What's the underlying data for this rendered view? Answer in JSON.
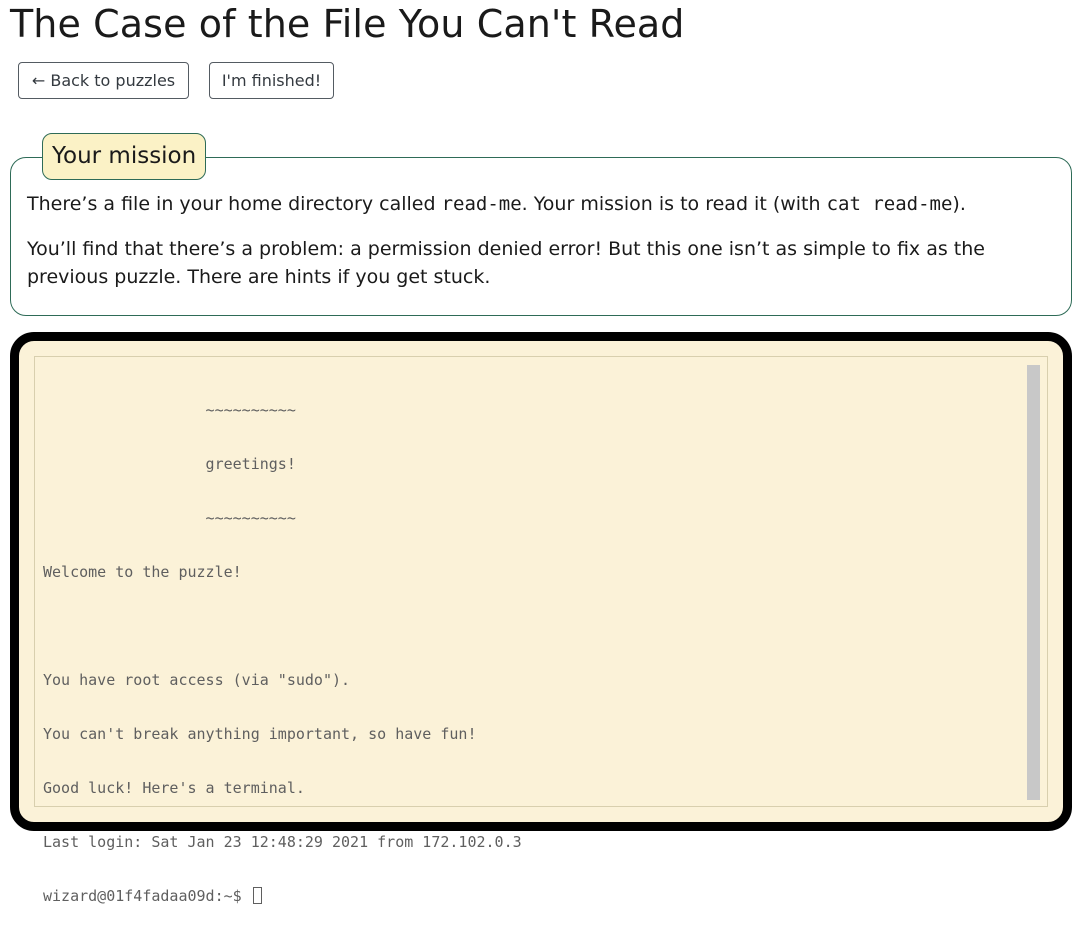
{
  "page": {
    "title": "The Case of the File You Can't Read"
  },
  "toolbar": {
    "back_label": "← Back to puzzles",
    "finished_label": "I'm finished!"
  },
  "mission": {
    "title": "Your mission",
    "p1_before": "There’s a file in your home directory called ",
    "p1_code1": "read-me",
    "p1_middle": ". Your mission is to read it (with ",
    "p1_code2": "cat read-me",
    "p1_after": ").",
    "p2": "You’ll find that there’s a problem: a permission denied error! But this one isn’t as simple to fix as the previous puzzle. There are hints if you get stuck."
  },
  "terminal": {
    "lines": [
      "                  ~~~~~~~~~~",
      "                  greetings!",
      "                  ~~~~~~~~~~",
      "Welcome to the puzzle!",
      "",
      "You have root access (via \"sudo\").",
      "You can't break anything important, so have fun!",
      "Good luck! Here's a terminal.",
      "Last login: Sat Jan 23 12:48:29 2021 from 172.102.0.3"
    ],
    "prompt": "wizard@01f4fadaa09d:~$ "
  },
  "colors": {
    "terminal_background": "#fbf2d8",
    "terminal_frame": "#000000",
    "mission_border": "#2e6b57",
    "mission_title_background": "#fbf2c6",
    "terminal_text": "#5f5f5f"
  }
}
